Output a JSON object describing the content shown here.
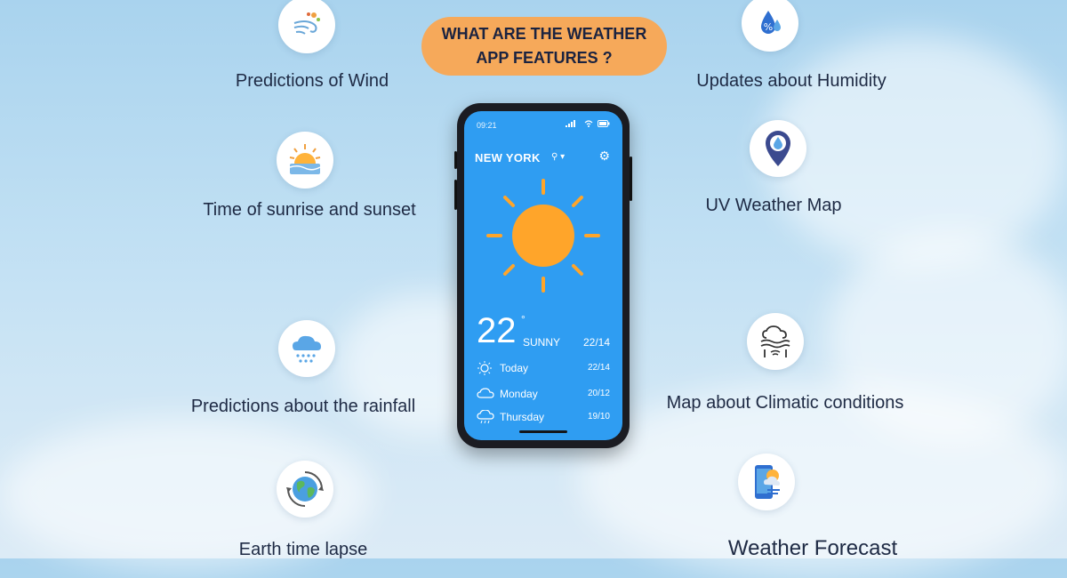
{
  "title": {
    "line1": "WHAT  ARE THE WEATHER",
    "line2": "APP FEATURES ?"
  },
  "features": {
    "wind": {
      "label": "Predictions of Wind",
      "icon": "wind-icon"
    },
    "sunrise": {
      "label": "Time of sunrise and sunset",
      "icon": "sunrise-icon"
    },
    "rainfall": {
      "label": "Predictions about the rainfall",
      "icon": "rain-cloud-icon"
    },
    "earth": {
      "label": "Earth time lapse",
      "icon": "earth-icon"
    },
    "humidity": {
      "label": "Updates about Humidity",
      "icon": "humidity-icon"
    },
    "uv": {
      "label": "UV Weather Map",
      "icon": "map-pin-icon"
    },
    "climatic": {
      "label": "Map about Climatic conditions",
      "icon": "climate-icon"
    },
    "forecast": {
      "label": "Weather Forecast",
      "icon": "phone-forecast-icon"
    }
  },
  "phone": {
    "time": "09:21",
    "city": "NEW YORK",
    "temperature": "22",
    "degree": "°",
    "condition": "SUNNY",
    "hilo": "22/14",
    "forecast": [
      {
        "day": "Today",
        "value": "22/14",
        "icon": "sun-icon"
      },
      {
        "day": "Monday",
        "value": "20/12",
        "icon": "cloud-icon"
      },
      {
        "day": "Thursday",
        "value": "19/10",
        "icon": "rain-cloud-icon"
      }
    ]
  },
  "colors": {
    "badge": "#f6a95a",
    "screen": "#2f9df2",
    "sun": "#ffa52a",
    "text": "#1e2a44"
  }
}
